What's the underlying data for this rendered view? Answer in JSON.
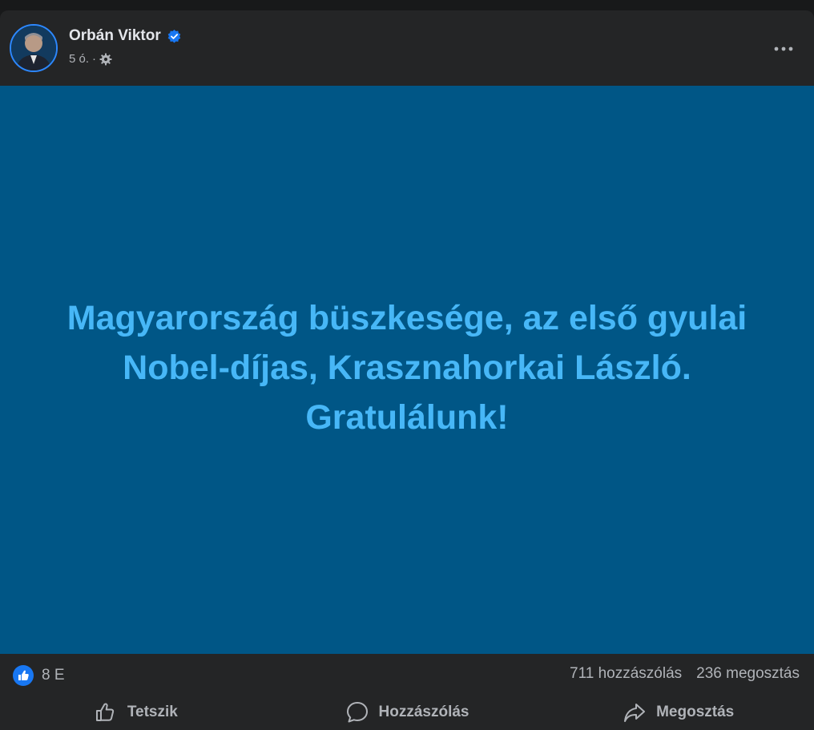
{
  "post": {
    "author": "Orbán Viktor",
    "time": "5 ó.",
    "separator": "·",
    "text": "Magyarország büszkesége, az első gyulai Nobel-díjas, Krasznahorkai László. Gratulálunk!",
    "background_color": "#005686",
    "text_color": "#47b7f7"
  },
  "stats": {
    "reaction_count": "8 E",
    "comments": "711 hozzászólás",
    "shares": "236 megosztás"
  },
  "actions": {
    "like": "Tetszik",
    "comment": "Hozzászólás",
    "share": "Megosztás"
  },
  "icons": {
    "verified": "verified-badge-icon",
    "privacy": "gear-icon",
    "more": "more-horizontal-icon",
    "like_reaction": "like-reaction-icon",
    "like": "thumbs-up-icon",
    "comment": "comment-bubble-icon",
    "share": "share-arrow-icon"
  },
  "colors": {
    "accent": "#1877f2",
    "card": "#242526",
    "secondary_text": "#b0b3b8"
  }
}
